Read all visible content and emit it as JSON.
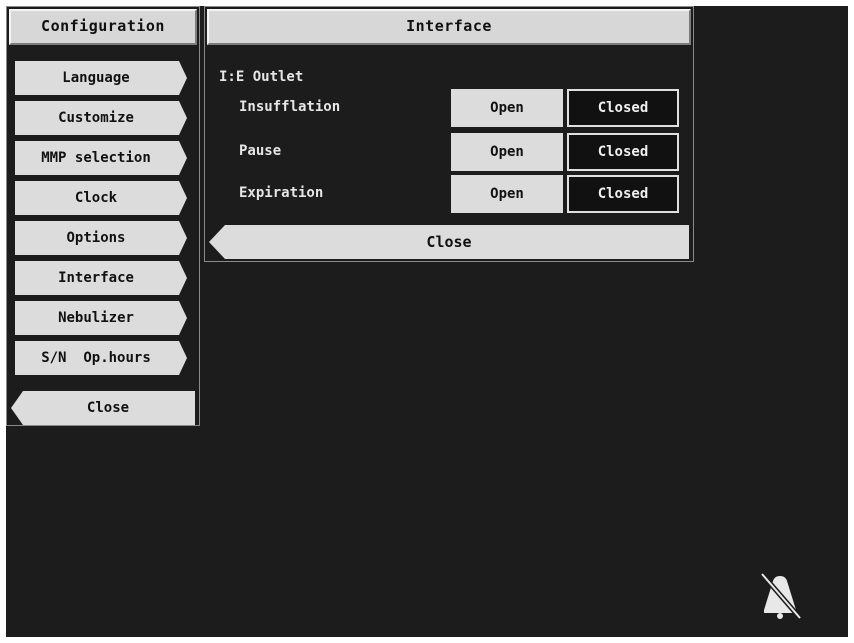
{
  "configuration": {
    "title": "Configuration",
    "menu_items": [
      {
        "label": "Language"
      },
      {
        "label": "Customize"
      },
      {
        "label": "MMP selection"
      },
      {
        "label": "Clock"
      },
      {
        "label": "Options"
      },
      {
        "label": "Interface"
      },
      {
        "label": "Nebulizer"
      },
      {
        "label": "S/N  Op.hours"
      }
    ],
    "close_label": "Close"
  },
  "interface": {
    "title": "Interface",
    "section": "I:E Outlet",
    "rows": [
      {
        "label": "Insufflation",
        "open": "Open",
        "closed": "Closed",
        "selected": "Closed"
      },
      {
        "label": "Pause",
        "open": "Open",
        "closed": "Closed",
        "selected": "Closed"
      },
      {
        "label": "Expiration",
        "open": "Open",
        "closed": "Closed",
        "selected": "Closed"
      }
    ],
    "close_label": "Close"
  },
  "status": {
    "alarm_icon": "bell-muted-icon"
  }
}
